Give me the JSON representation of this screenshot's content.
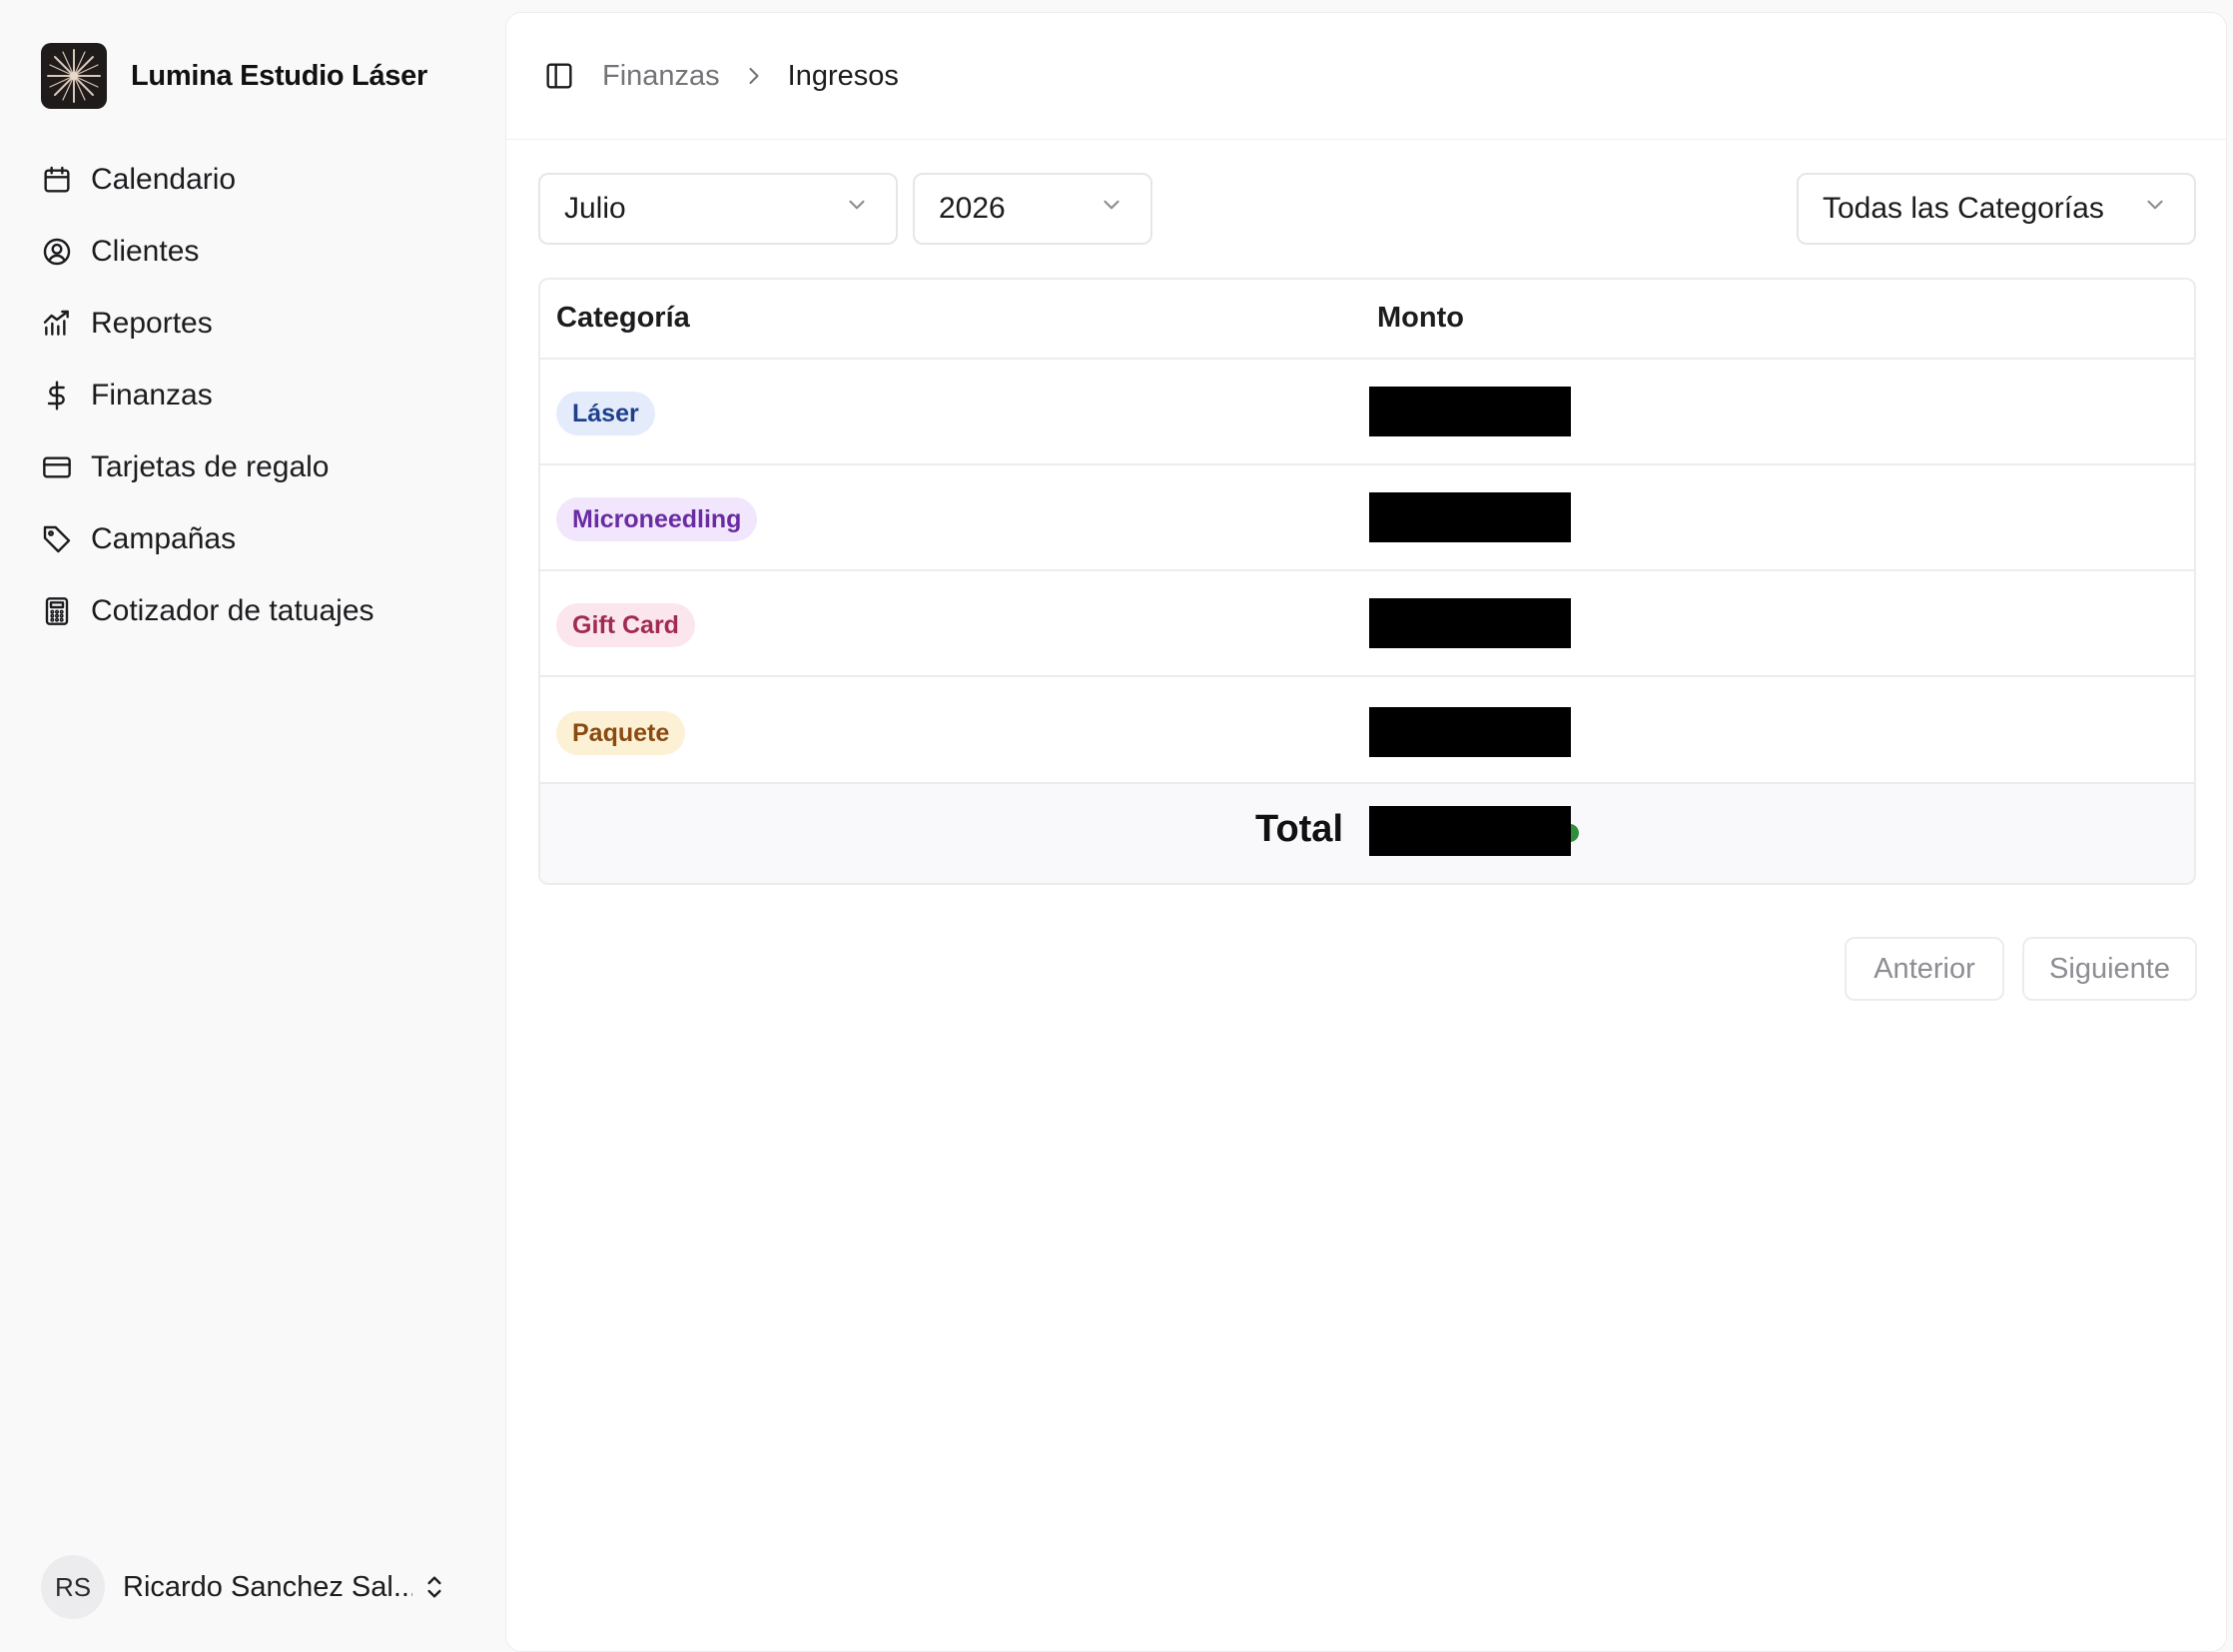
{
  "brand": {
    "name": "Lumina Estudio Láser",
    "logo": "starburst-logo"
  },
  "sidebar": {
    "items": [
      {
        "label": "Calendario",
        "icon": "calendar-icon"
      },
      {
        "label": "Clientes",
        "icon": "user-circle-icon"
      },
      {
        "label": "Reportes",
        "icon": "chart-icon"
      },
      {
        "label": "Finanzas",
        "icon": "dollar-icon"
      },
      {
        "label": "Tarjetas de regalo",
        "icon": "credit-card-icon"
      },
      {
        "label": "Campañas",
        "icon": "tag-icon"
      },
      {
        "label": "Cotizador de tatuajes",
        "icon": "calculator-icon"
      }
    ]
  },
  "user": {
    "initials": "RS",
    "name": "Ricardo Sanchez Sal..."
  },
  "breadcrumb": {
    "parent": "Finanzas",
    "current": "Ingresos"
  },
  "filters": {
    "month": "Julio",
    "year": "2026",
    "category": "Todas las Categorías"
  },
  "table": {
    "headers": {
      "category": "Categoría",
      "amount": "Monto"
    },
    "rows": [
      {
        "category": "Láser",
        "bg": "#e4ecfb",
        "fg": "#1e3f8a"
      },
      {
        "category": "Microneedling",
        "bg": "#f1e6fb",
        "fg": "#6a2ca3"
      },
      {
        "category": "Gift Card",
        "bg": "#fbe6ee",
        "fg": "#a12a55"
      },
      {
        "category": "Paquete",
        "bg": "#fcf1d4",
        "fg": "#8a4a12"
      }
    ],
    "total_label": "Total"
  },
  "pagination": {
    "prev": "Anterior",
    "next": "Siguiente"
  }
}
